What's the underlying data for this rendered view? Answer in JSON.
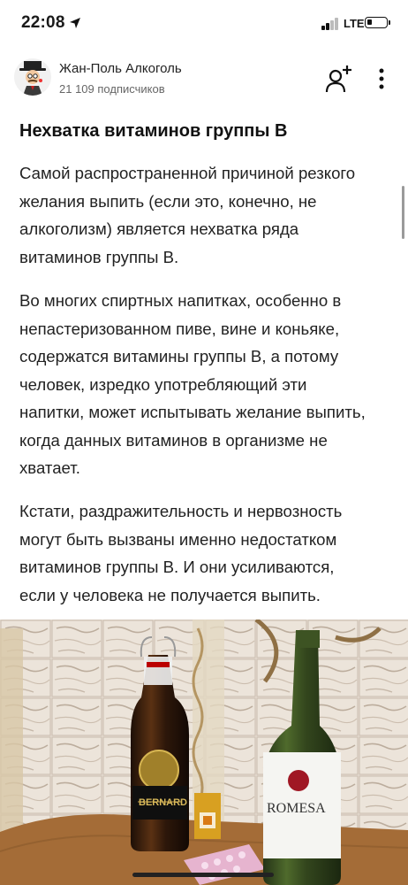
{
  "status_bar": {
    "time": "22:08",
    "network": "LTE"
  },
  "channel": {
    "name": "Жан-Поль Алкоголь",
    "subscribers": "21 109 подписчиков"
  },
  "article": {
    "heading": "Нехватка витаминов группы В",
    "paragraphs": [
      "Самой распространенной причиной резкого желания выпить (если это, конечно, не алкоголизм) является нехватка ряда витаминов группы В.",
      "Во многих спиртных напитках, особенно в непастеризованном пиве, вине и коньяке, содержатся витамины группы В, а потому человек, изредко употребляющий эти напитки, может испытывать желание выпить, когда данных витаминов в организме не хватает.",
      "Кстати, раздражительность и нервозность могут быть вызваны именно недостатком витаминов группы В. И они усиливаются, если у человека не получается выпить."
    ]
  },
  "photo": {
    "beer_label": "BERNARD",
    "wine_label": "ROMESA"
  },
  "icons": {
    "location": "location-arrow-icon",
    "signal": "cellular-signal-icon",
    "battery": "battery-icon",
    "subscribe": "add-person-icon",
    "more": "vertical-dots-icon"
  },
  "colors": {
    "text": "#222222",
    "muted": "#666666",
    "background": "#ffffff"
  }
}
